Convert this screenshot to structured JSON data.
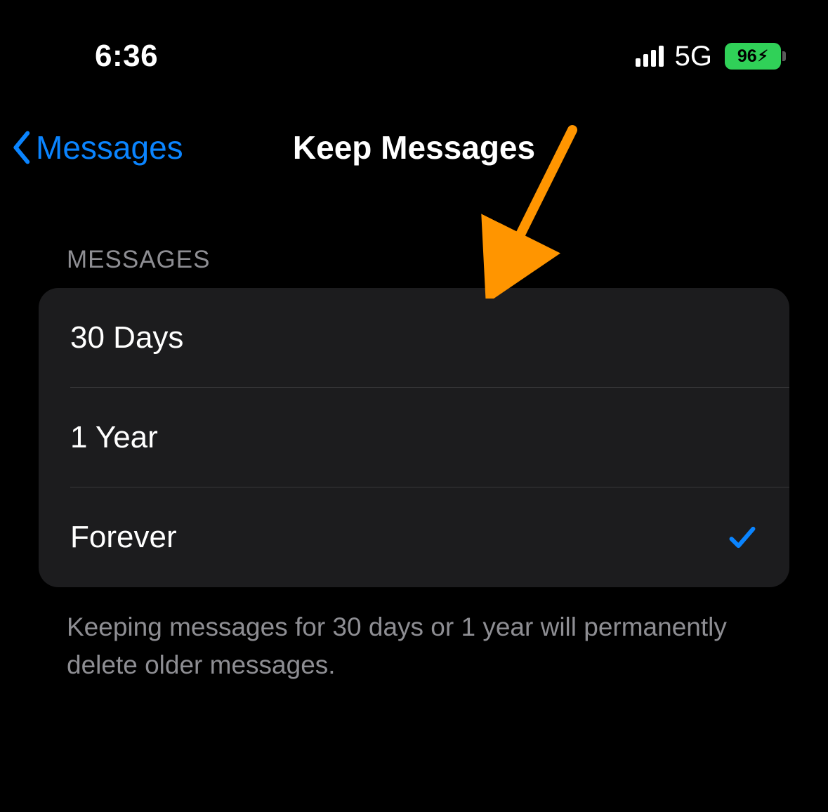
{
  "status": {
    "time": "6:36",
    "network": "5G",
    "battery": "96"
  },
  "nav": {
    "back_label": "Messages",
    "title": "Keep Messages"
  },
  "section": {
    "header": "MESSAGES",
    "options": [
      {
        "label": "30 Days",
        "selected": false
      },
      {
        "label": "1 Year",
        "selected": false
      },
      {
        "label": "Forever",
        "selected": true
      }
    ],
    "footer": "Keeping messages for 30 days or 1 year will permanently delete older messages."
  }
}
